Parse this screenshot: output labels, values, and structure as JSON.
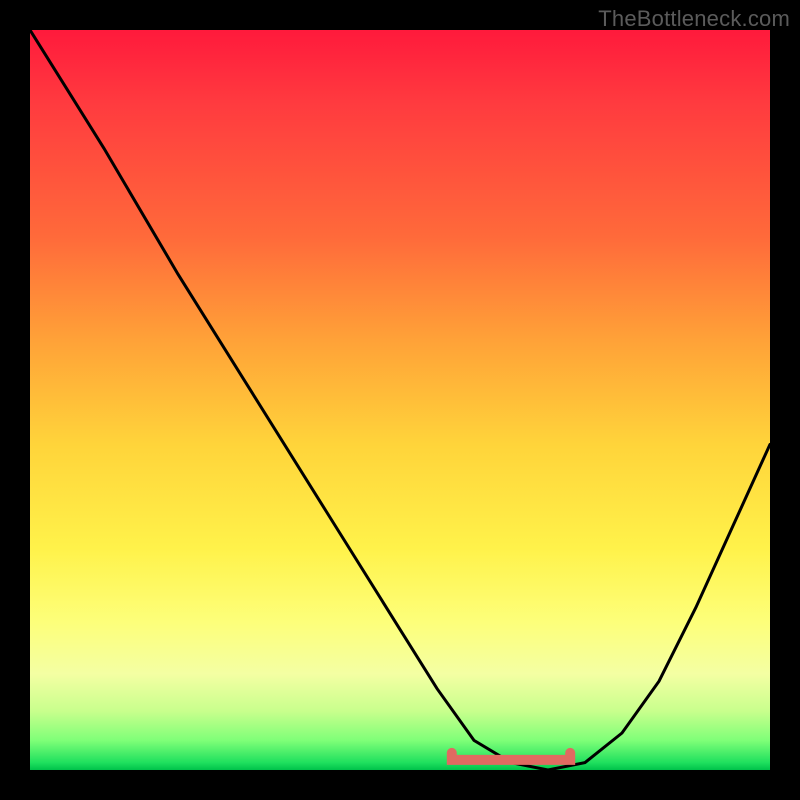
{
  "watermark": "TheBottleneck.com",
  "chart_data": {
    "type": "line",
    "title": "",
    "xlabel": "",
    "ylabel": "",
    "xlim": [
      0,
      100
    ],
    "ylim": [
      0,
      100
    ],
    "grid": false,
    "legend": false,
    "background_gradient": {
      "stops": [
        {
          "pos": 0,
          "color": "#ff1a3c"
        },
        {
          "pos": 10,
          "color": "#ff3b3f"
        },
        {
          "pos": 28,
          "color": "#ff6a3a"
        },
        {
          "pos": 42,
          "color": "#ffa238"
        },
        {
          "pos": 56,
          "color": "#ffd43a"
        },
        {
          "pos": 70,
          "color": "#fff24a"
        },
        {
          "pos": 80,
          "color": "#fdff7a"
        },
        {
          "pos": 87,
          "color": "#f4ffa3"
        },
        {
          "pos": 92,
          "color": "#c9ff8d"
        },
        {
          "pos": 96,
          "color": "#7fff78"
        },
        {
          "pos": 99,
          "color": "#1fe05e"
        },
        {
          "pos": 100,
          "color": "#00c24a"
        }
      ]
    },
    "series": [
      {
        "name": "bottleneck-curve",
        "color": "#000000",
        "x": [
          0,
          5,
          10,
          20,
          30,
          40,
          50,
          55,
          60,
          65,
          70,
          75,
          80,
          85,
          90,
          95,
          100
        ],
        "y": [
          100,
          92,
          84,
          67,
          51,
          35,
          19,
          11,
          4,
          1,
          0,
          1,
          5,
          12,
          22,
          33,
          44
        ]
      }
    ],
    "annotations": [
      {
        "name": "optimal-range-marker",
        "type": "segment",
        "color": "#e06a61",
        "linewidth": 10,
        "x0": 57,
        "y0": 1.5,
        "x1": 73,
        "y1": 1.5,
        "end_caps": true
      }
    ]
  }
}
